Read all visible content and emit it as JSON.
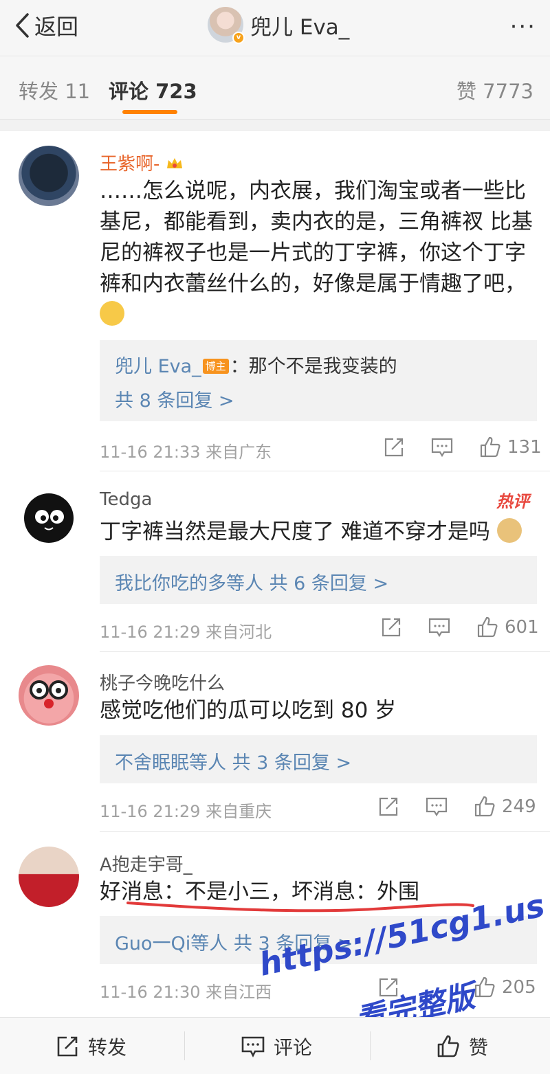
{
  "header": {
    "back_label": "返回",
    "title": "兜儿 Eva_",
    "more": "···"
  },
  "tabs": {
    "repost": "转发 11",
    "comments": "评论 723",
    "likes": "赞 7773"
  },
  "comments": [
    {
      "name": "王紫啊-",
      "text": "……怎么说呢，内衣展，我们淘宝或者一些比基尼，都能看到，卖内衣的是，三角裤衩 比基尼的裤衩子也是一片式的丁字裤，你这个丁字裤和内衣蕾丝什么的，好像是属于情趣了吧，",
      "reply_author": "兜儿 Eva_",
      "reply_badge": "博主",
      "reply_text": "：那个不是我变装的",
      "reply_more": "共 8 条回复 >",
      "meta": "11-16 21:33 来自广东",
      "likes": "131"
    },
    {
      "name": "Tedga",
      "hot": "热评",
      "text": "丁字裤当然是最大尺度了 难道不穿才是吗",
      "reply_summary": "我比你吃的多等人  共 6 条回复 >",
      "meta": "11-16 21:29 来自河北",
      "likes": "601"
    },
    {
      "name": "桃子今晚吃什么",
      "text": "感觉吃他们的瓜可以吃到 80 岁",
      "reply_summary": "不舍眠眠等人  共 3 条回复 >",
      "meta": "11-16 21:29 来自重庆",
      "likes": "249"
    },
    {
      "name": "A抱走宇哥_",
      "text": "好消息：不是小三，坏消息：外围",
      "reply_summary": "Guo一Qi等人  共 3 条回复 >",
      "meta": "11-16 21:30 来自江西",
      "likes": "205"
    }
  ],
  "bottom": {
    "repost": "转发",
    "comment": "评论",
    "like": "赞"
  },
  "watermark": {
    "url": "https://51cg1.us",
    "text": "看完整版"
  },
  "colors": {
    "accent": "#ff8200",
    "link": "#5b86b3",
    "username_vip": "#e8652b",
    "watermark": "#2f49c9",
    "hot": "#e8483e"
  }
}
